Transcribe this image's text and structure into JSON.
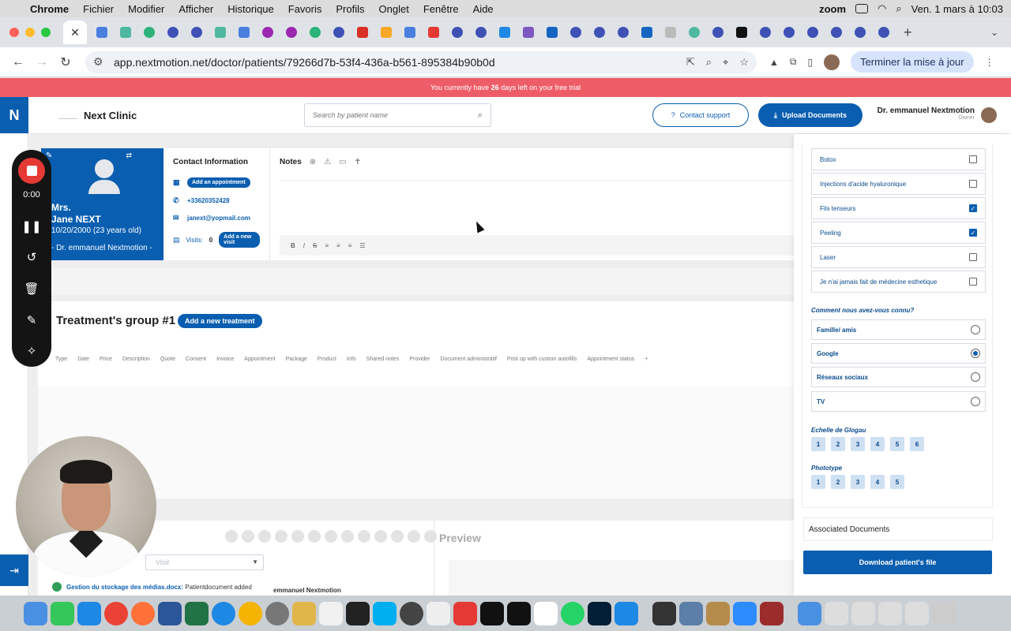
{
  "menubar": {
    "app": "Chrome",
    "items": [
      "Fichier",
      "Modifier",
      "Afficher",
      "Historique",
      "Favoris",
      "Profils",
      "Onglet",
      "Fenêtre",
      "Aide"
    ],
    "zoom_label": "zoom",
    "datetime": "Ven. 1 mars à 10:03"
  },
  "browser": {
    "url": "app.nextmotion.net/doctor/patients/79266d7b-53f4-436a-b561-895384b90b0d",
    "finish_setup": "Terminer la mise à jour",
    "new_tab": "+"
  },
  "trial_banner": {
    "before": "You currently have ",
    "days": "26",
    "after": " days left on your free trial"
  },
  "app": {
    "logo_letter": "N",
    "clinic_name": "Next Clinic",
    "search_placeholder": "Search by patient name",
    "contact_support": "Contact support",
    "upload_documents": "Upload Documents",
    "doctor_name": "Dr. emmanuel Nextmotion",
    "doctor_role": "Owner"
  },
  "patient": {
    "title": "Mrs.",
    "name": "Jane NEXT",
    "dob": "10/20/2000  (23 years old)",
    "doctor": "- Dr. emmanuel Nextmotion -"
  },
  "contact": {
    "heading": "Contact Information",
    "add_appointment": "Add an appointment",
    "phone": "+33620352428",
    "email": "janext@yopmail.com",
    "visits_label": "Visits:",
    "visits_count": "0",
    "add_visit": "Add a new visit"
  },
  "notes": {
    "heading": "Notes",
    "tools": [
      "B",
      "I",
      "S"
    ]
  },
  "treatment": {
    "title": "Treatment's group #1",
    "add_button": "Add a new treatment",
    "columns": [
      "Type",
      "Date",
      "Price",
      "Description",
      "Quote",
      "Consent",
      "Invoice",
      "Appointment",
      "Package",
      "Product",
      "Info",
      "Shared notes",
      "Provider",
      "Document administratif",
      "Post op with custom autofills",
      "Appointment status",
      "+"
    ]
  },
  "bottom": {
    "preview": "Preview",
    "visit_select": "Visit",
    "notification_file": "Gestion du stockage des médias.docx:",
    "notification_text": " Patientdocument added",
    "author": "emmanuel Nextmotion"
  },
  "questionnaire": {
    "treatments": [
      {
        "label": "Botox",
        "checked": false
      },
      {
        "label": "Injections d'acide hyaluronique",
        "checked": false
      },
      {
        "label": "Fils tenseurs",
        "checked": true
      },
      {
        "label": "Peeling",
        "checked": true
      },
      {
        "label": "Laser",
        "checked": false
      },
      {
        "label": "Je n'ai jamais fait de médecine esthetique",
        "checked": false
      }
    ],
    "source_question": "Comment nous avez-vous connu?",
    "sources": [
      {
        "label": "Famille/ amis",
        "selected": false
      },
      {
        "label": "Google",
        "selected": true
      },
      {
        "label": "Réseaux sociaux",
        "selected": false
      },
      {
        "label": "TV",
        "selected": false
      }
    ],
    "glogau_label": "Echelle de Glogau",
    "glogau": [
      "1",
      "2",
      "3",
      "4",
      "5",
      "6"
    ],
    "phototype_label": "Phototype",
    "phototype": [
      "1",
      "2",
      "3",
      "4",
      "5"
    ],
    "associated_documents": "Associated Documents",
    "download_button": "Download patient's file"
  },
  "recorder": {
    "time": "0:00"
  },
  "colors": {
    "brand": "#0a5eb0",
    "banner": "#ee5d67",
    "record": "#e53935"
  }
}
